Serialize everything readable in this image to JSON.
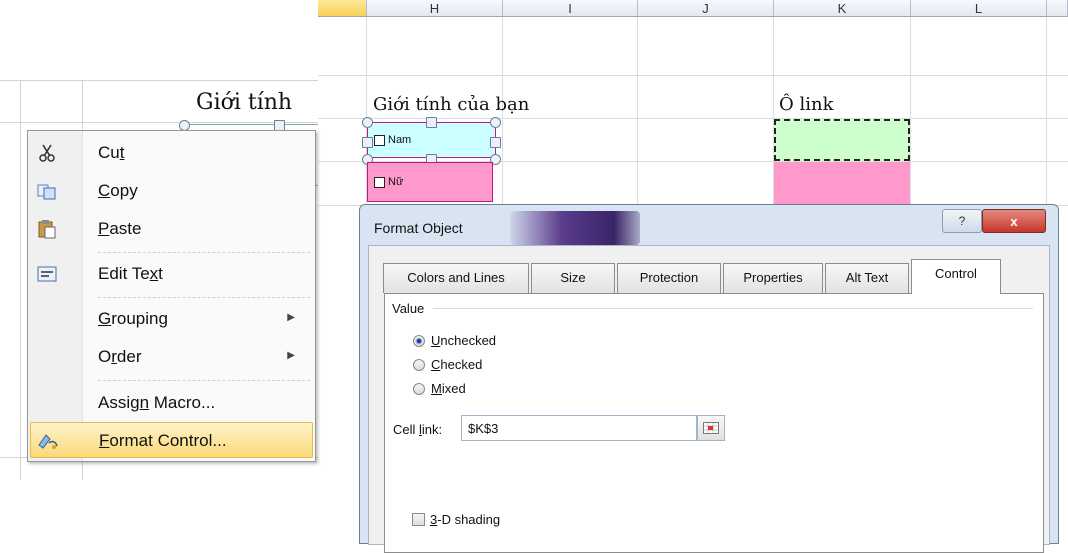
{
  "left_sheet": {
    "heading": "Giới tính"
  },
  "columns": [
    "H",
    "I",
    "J",
    "K",
    "L"
  ],
  "sheet": {
    "gender_title": "Giới tính của bạn",
    "link_title": "Ô link",
    "checkbox_nam": "Nam",
    "checkbox_nu": "Nữ",
    "colors": {
      "nam_fill": "#ccffff",
      "nu_fill": "#ff99cc",
      "link_green": "#ccffcc",
      "link_pink": "#ff99cc",
      "border_accent": "#c0148c"
    }
  },
  "context_menu": {
    "items": [
      {
        "pre": "Cu",
        "key": "t",
        "post": "",
        "icon": "scissors-icon"
      },
      {
        "pre": "",
        "key": "C",
        "post": "opy",
        "icon": "copy-icon"
      },
      {
        "pre": "",
        "key": "P",
        "post": "aste",
        "icon": "paste-icon"
      },
      {
        "pre": "Edit Te",
        "key": "x",
        "post": "t",
        "icon": "edit-text-icon"
      },
      {
        "pre": "",
        "key": "G",
        "post": "rouping",
        "icon": ""
      },
      {
        "pre": "O",
        "key": "r",
        "post": "der",
        "icon": ""
      },
      {
        "pre": "Assig",
        "key": "n",
        "post": " Macro...",
        "icon": ""
      },
      {
        "pre": "",
        "key": "F",
        "post": "ormat Control...",
        "icon": "format-control-icon"
      }
    ]
  },
  "dialog": {
    "title": "Format Object",
    "help_glyph": "?",
    "close_glyph": "x",
    "tabs": [
      "Colors and Lines",
      "Size",
      "Protection",
      "Properties",
      "Alt Text",
      "Control"
    ],
    "active_tab": "Control",
    "value_group_label": "Value",
    "radios": [
      {
        "pre": "",
        "key": "U",
        "post": "nchecked",
        "selected": true
      },
      {
        "pre": "",
        "key": "C",
        "post": "hecked",
        "selected": false
      },
      {
        "pre": "",
        "key": "M",
        "post": "ixed",
        "selected": false
      }
    ],
    "cell_link_label_pre": "Cell ",
    "cell_link_label_key": "l",
    "cell_link_label_post": "ink:",
    "cell_link_value": "$K$3",
    "shading_key": "3",
    "shading_post": "-D shading",
    "shading_checked": false
  }
}
